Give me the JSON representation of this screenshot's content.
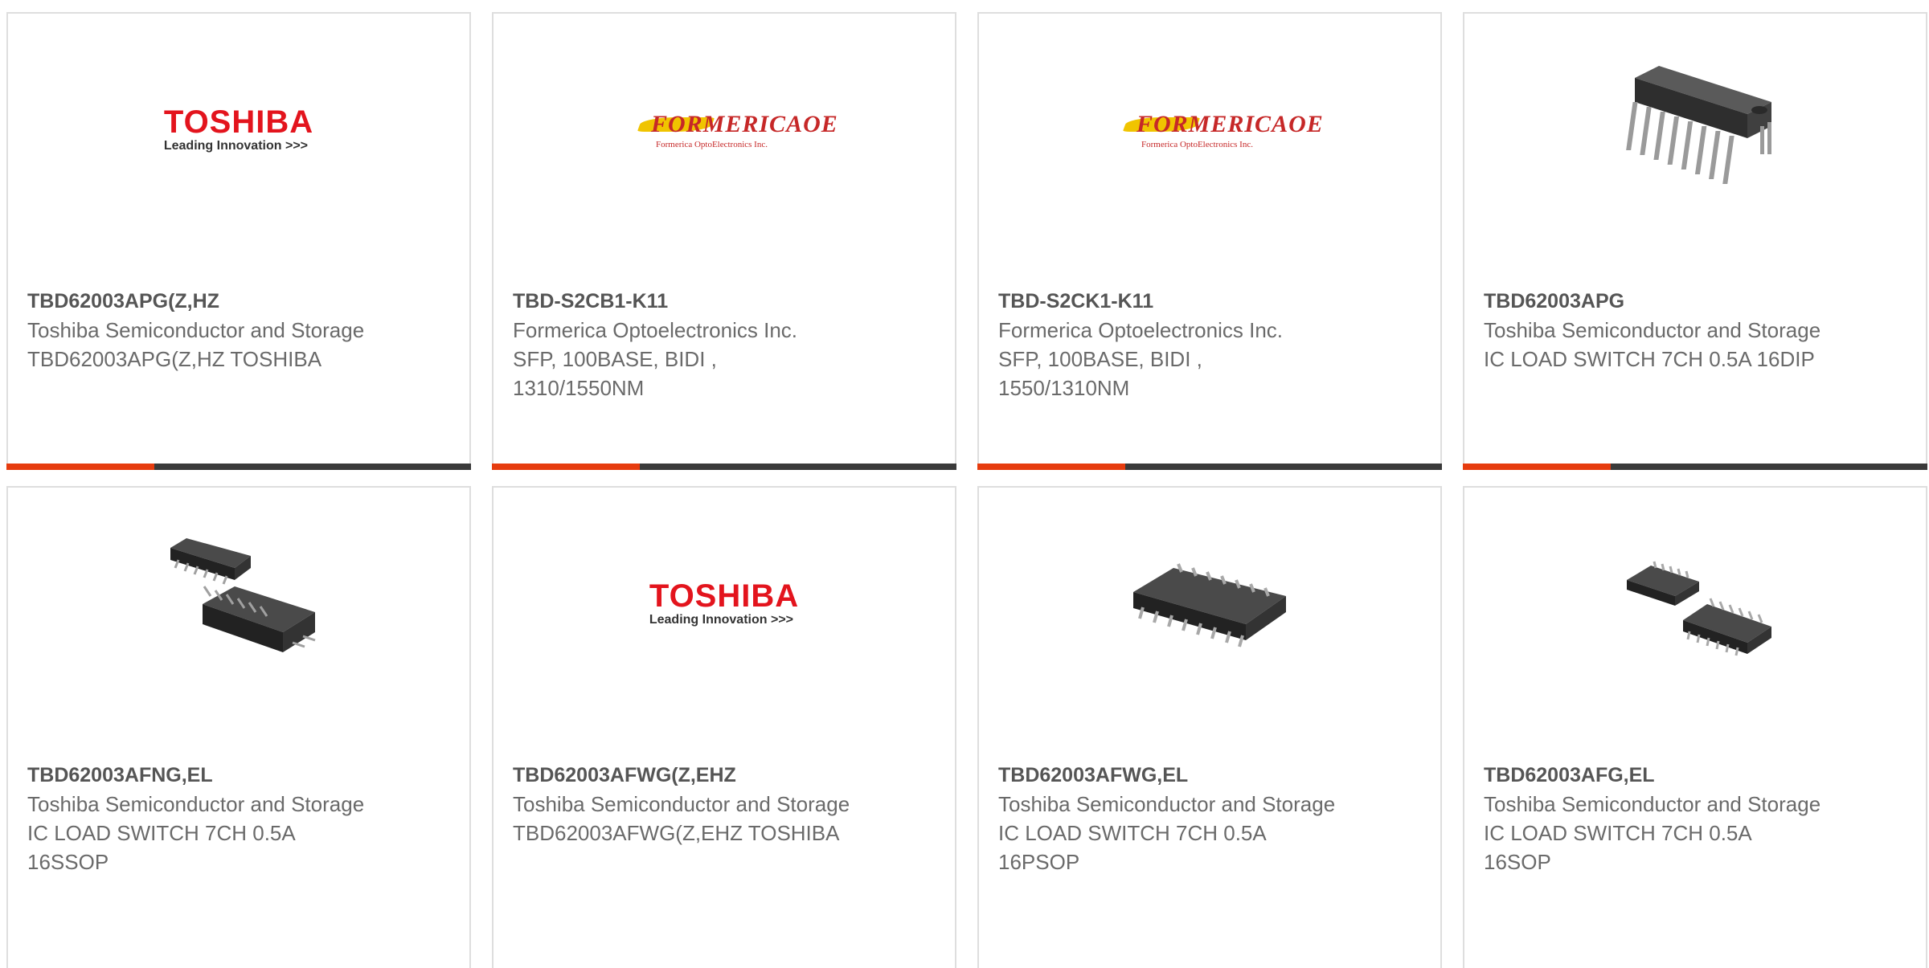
{
  "logos": {
    "toshiba": {
      "word": "TOSHIBA",
      "tagline": "Leading Innovation >>>",
      "color": "#e3141d"
    },
    "formerica": {
      "word": "FORMERICAOE",
      "sub": "Formerica OptoElectronics Inc.",
      "color": "#c62828"
    }
  },
  "accent_colors": {
    "primary": "#e63c0f",
    "secondary": "#3a3a3a"
  },
  "products": [
    {
      "part": "TBD62003APG(Z,HZ",
      "manufacturer": "Toshiba Semiconductor and Storage",
      "description": "TBD62003APG(Z,HZ TOSHIBA",
      "image": "toshiba-logo"
    },
    {
      "part": "TBD-S2CB1-K11",
      "manufacturer": "Formerica Optoelectronics Inc.",
      "description": "SFP, 100BASE, BIDI , 1310/1550NM",
      "image": "formerica-logo"
    },
    {
      "part": "TBD-S2CK1-K11",
      "manufacturer": "Formerica Optoelectronics Inc.",
      "description": "SFP, 100BASE, BIDI , 1550/1310NM",
      "image": "formerica-logo"
    },
    {
      "part": "TBD62003APG",
      "manufacturer": "Toshiba Semiconductor and Storage",
      "description": "IC LOAD SWITCH 7CH 0.5A 16DIP",
      "image": "dip-chip"
    },
    {
      "part": "TBD62003AFNG,EL",
      "manufacturer": "Toshiba Semiconductor and Storage",
      "description": "IC LOAD SWITCH 7CH 0.5A 16SSOP",
      "image": "ssop-chip"
    },
    {
      "part": "TBD62003AFWG(Z,EHZ",
      "manufacturer": "Toshiba Semiconductor and Storage",
      "description": "TBD62003AFWG(Z,EHZ TOSHIBA",
      "image": "toshiba-logo"
    },
    {
      "part": "TBD62003AFWG,EL",
      "manufacturer": "Toshiba Semiconductor and Storage",
      "description": "IC LOAD SWITCH 7CH 0.5A 16PSOP",
      "image": "psop-chip"
    },
    {
      "part": "TBD62003AFG,EL",
      "manufacturer": "Toshiba Semiconductor and Storage",
      "description": "IC LOAD SWITCH 7CH 0.5A 16SOP",
      "image": "sop-chip"
    }
  ]
}
